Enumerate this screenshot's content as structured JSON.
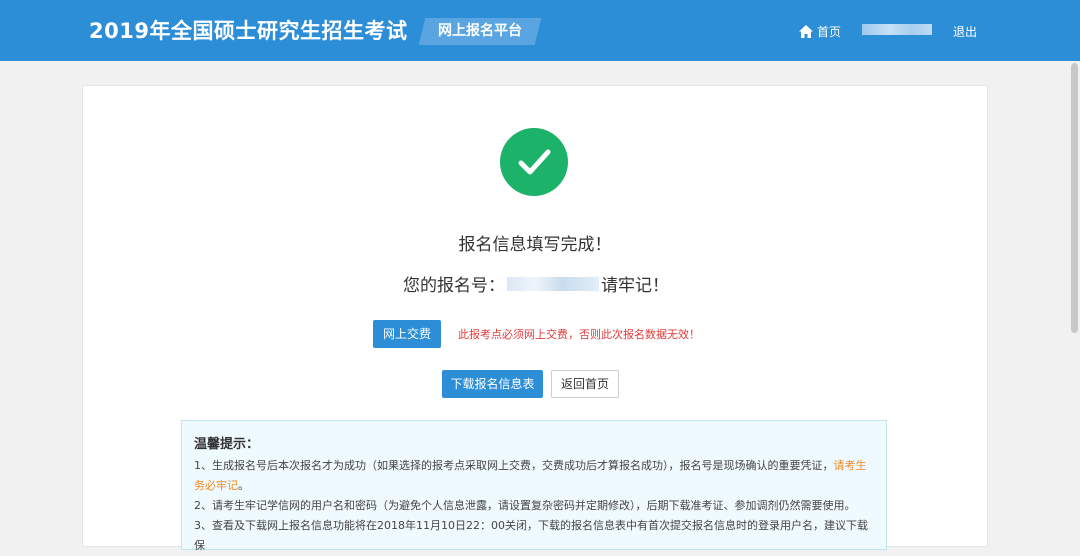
{
  "header": {
    "site_title": "2019年全国硕士研究生招生考试",
    "platform_label": "网上报名平台",
    "nav_home": "首页",
    "logout": "退出"
  },
  "result": {
    "complete_message": "报名信息填写完成！",
    "number_prefix": "您的报名号：",
    "number_suffix": "请牢记！"
  },
  "actions": {
    "pay_label": "网上交费",
    "pay_warning": "此报考点必须网上交费，否则此次报名数据无效！",
    "download_label": "下载报名信息表",
    "return_home_label": "返回首页"
  },
  "tips": {
    "title": "温馨提示：",
    "item1_text": "1、生成报名号后本次报名才为成功（如果选择的报考点采取网上交费，交费成功后才算报名成功），报名号是现场确认的重要凭证，",
    "item1_highlight": "请考生务必牢记",
    "item1_end": "。",
    "item2_text": "2、请考生牢记学信网的用户名和密码（为避免个人信息泄露，请设置复杂密码并定期修改），后期下载准考证、参加调剂仍然需要使用。",
    "item3_text": "3、查看及下载网上报名信息功能将在2018年11月10日22：00关闭，下载的报名信息表中有首次提交报名信息时的登录用户名，建议下载保"
  },
  "colors": {
    "header_bg": "#2d8ed8",
    "success": "#1db26a",
    "warning": "#e23a3a",
    "highlight": "#f08a24"
  }
}
